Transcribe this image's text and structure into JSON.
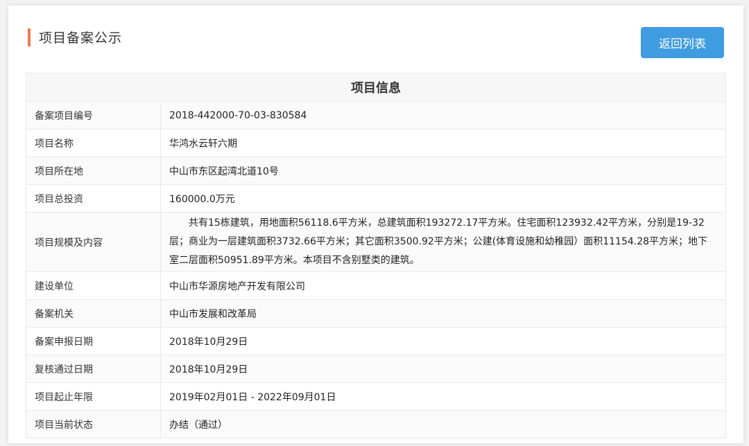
{
  "page": {
    "title": "项目备案公示",
    "back_button": "返回列表",
    "accent_color": "#f0784f",
    "button_color": "#3f9ce0"
  },
  "table": {
    "heading": "项目信息",
    "rows": [
      {
        "label": "备案项目编号",
        "value": "2018-442000-70-03-830584"
      },
      {
        "label": "项目名称",
        "value": "华鸿水云轩六期"
      },
      {
        "label": "项目所在地",
        "value": "中山市东区起湾北道10号"
      },
      {
        "label": "项目总投资",
        "value": "160000.0万元"
      },
      {
        "label": "项目规模及内容",
        "value": "共有15栋建筑，用地面积56118.6平方米，总建筑面积193272.17平方米。住宅面积123932.42平方米，分别是19-32层；商业为一层建筑面积3732.66平方米；其它面积3500.92平方米；公建(体育设施和幼稚园）面积11154.28平方米；地下室二层面积50951.89平方米。本项目不含别墅类的建筑。"
      },
      {
        "label": "建设单位",
        "value": "中山市华源房地产开发有限公司"
      },
      {
        "label": "备案机关",
        "value": "中山市发展和改革局"
      },
      {
        "label": "备案申报日期",
        "value": "2018年10月29日"
      },
      {
        "label": "复核通过日期",
        "value": "2018年10月29日"
      },
      {
        "label": "项目起止年限",
        "value": "2019年02月01日 - 2022年09月01日"
      },
      {
        "label": "项目当前状态",
        "value": "办结（通过）"
      }
    ]
  }
}
